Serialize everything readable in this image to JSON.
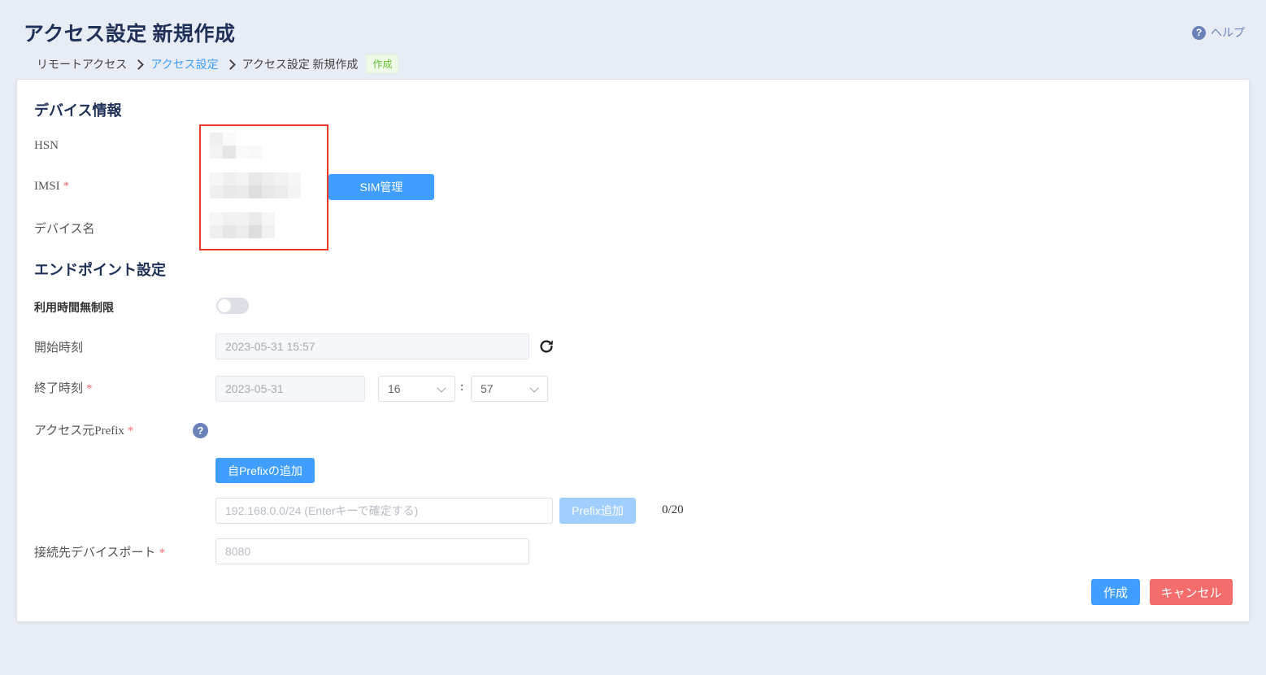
{
  "header": {
    "title": "アクセス設定 新規作成",
    "help_label": "ヘルプ",
    "help_icon": "question-circle-icon"
  },
  "breadcrumb": {
    "items": [
      "リモートアクセス",
      "アクセス設定",
      "アクセス設定 新規作成"
    ],
    "tag": "作成"
  },
  "device_section": {
    "title": "デバイス情報",
    "hsn_label": "HSN",
    "imsi_label": "IMSI",
    "device_name_label": "デバイス名",
    "sim_button": "SIM管理"
  },
  "endpoint_section": {
    "title": "エンドポイント設定",
    "unlimited_label": "利用時間無制限",
    "unlimited_enabled": false,
    "start_label": "開始時刻",
    "start_value": "2023-05-31 15:57",
    "end_label": "終了時刻",
    "end_date": "2023-05-31",
    "end_hour": "16",
    "end_minute": "57",
    "time_separator": ":",
    "prefix_label": "アクセス元Prefix",
    "add_own_prefix_button": "自Prefixの追加",
    "prefix_placeholder": "192.168.0.0/24 (Enterキーで確定する)",
    "prefix_add_button": "Prefix追加",
    "prefix_count": "0/20",
    "port_label": "接続先デバイスポート",
    "port_placeholder": "8080"
  },
  "actions": {
    "create_button": "作成",
    "cancel_button": "キャンセル"
  },
  "required_mark": "*",
  "colors": {
    "primary": "#409eff",
    "danger": "#f56c6c",
    "highlight_box": "#e8392a",
    "title": "#1f3158"
  }
}
